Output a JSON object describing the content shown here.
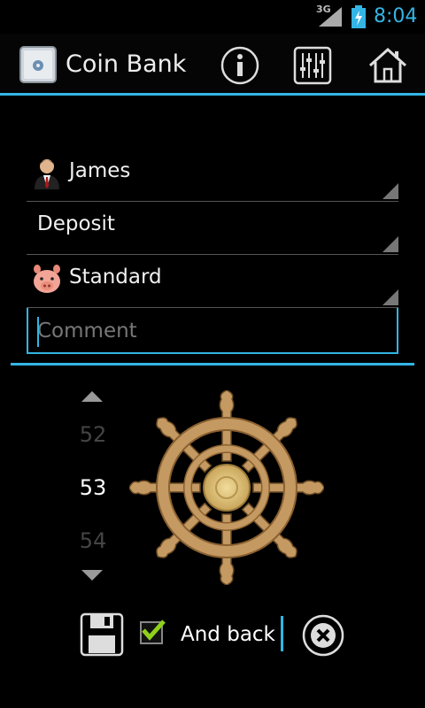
{
  "status": {
    "network": "3G",
    "time": "8:04"
  },
  "app": {
    "title": "Coin Bank"
  },
  "form": {
    "person": "James",
    "operation": "Deposit",
    "account": "Standard",
    "comment_placeholder": "Comment",
    "comment_value": ""
  },
  "picker": {
    "above": "52",
    "selected": "53",
    "below": "54"
  },
  "bottom": {
    "and_back_label": "And back",
    "and_back_checked": true
  },
  "colors": {
    "accent": "#33b5e5"
  }
}
